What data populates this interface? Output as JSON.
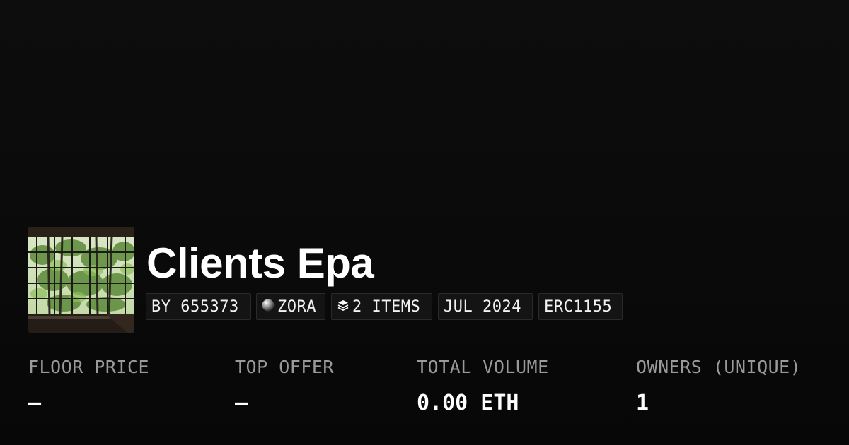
{
  "collection": {
    "title": "Clients Epa",
    "thumbnail_icon": "window-bamboo-image"
  },
  "tags": {
    "creator": "BY 655373",
    "chain": "ZORA",
    "chain_icon": "sphere-icon",
    "items": "2 ITEMS",
    "items_icon": "layers-icon",
    "date": "JUL 2024",
    "standard": "ERC1155"
  },
  "stats": {
    "floor_price_label": "FLOOR PRICE",
    "floor_price_value": "–",
    "top_offer_label": "TOP OFFER",
    "top_offer_value": "–",
    "total_volume_label": "TOTAL VOLUME",
    "total_volume_value": "0.00 ETH",
    "owners_label": "OWNERS (UNIQUE)",
    "owners_value": "1"
  },
  "colors": {
    "background": "#0a0a0a",
    "label_gray": "#9a9a9a",
    "tag_border": "#2a2a2a"
  }
}
